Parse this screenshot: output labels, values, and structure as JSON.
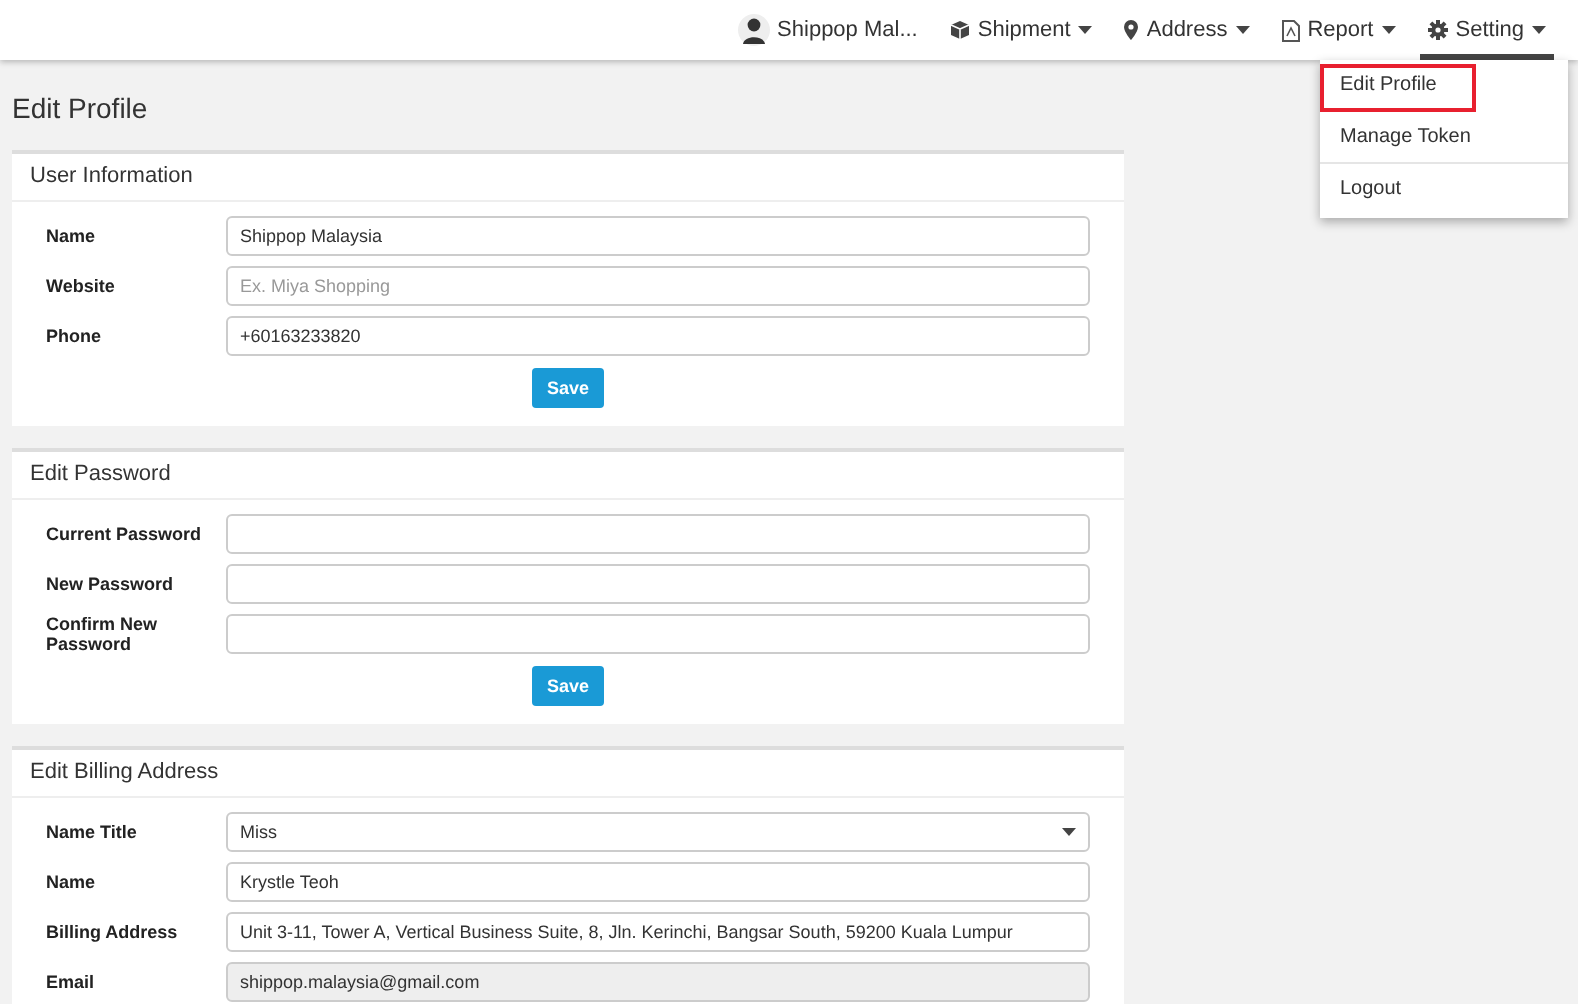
{
  "navbar": {
    "user": "Shippop Mal...",
    "menus": [
      {
        "label": "Shipment",
        "open": false
      },
      {
        "label": "Address",
        "open": false
      },
      {
        "label": "Report",
        "open": false
      },
      {
        "label": "Setting",
        "open": true
      }
    ]
  },
  "dropdown": {
    "items": [
      {
        "label": "Edit Profile",
        "selected": true
      },
      {
        "label": "Manage Token",
        "selected": false
      },
      {
        "label": "Logout",
        "selected": false
      }
    ]
  },
  "page_title": "Edit Profile",
  "sections": [
    {
      "title": "User Information",
      "button": "Save",
      "fields": [
        {
          "label": "Name",
          "kind": "text",
          "value": "Shippop Malaysia",
          "disabled": false
        },
        {
          "label": "Website",
          "kind": "text",
          "placeholder": "Ex. Miya Shopping",
          "disabled": false
        },
        {
          "label": "Phone",
          "kind": "text",
          "value": "+60163233820",
          "disabled": false
        }
      ]
    },
    {
      "title": "Edit Password",
      "button": "Save",
      "fields": [
        {
          "label": "Current Password",
          "kind": "password",
          "disabled": false
        },
        {
          "label": "New Password",
          "kind": "password",
          "disabled": false
        },
        {
          "label": "Confirm New Password",
          "kind": "password",
          "disabled": false
        }
      ]
    },
    {
      "title": "Edit Billing Address",
      "fields": [
        {
          "label": "Name Title",
          "kind": "select",
          "value": "Miss",
          "disabled": false
        },
        {
          "label": "Name",
          "kind": "text",
          "value": "Krystle Teoh",
          "disabled": false
        },
        {
          "label": "Billing Address",
          "kind": "text",
          "value": "Unit 3-11, Tower A, Vertical Business Suite, 8, Jln. Kerinchi, Bangsar South, 59200 Kuala Lumpur",
          "disabled": false
        },
        {
          "label": "Email",
          "kind": "text",
          "value": "shippop.malaysia@gmail.com",
          "disabled": true
        }
      ]
    }
  ]
}
